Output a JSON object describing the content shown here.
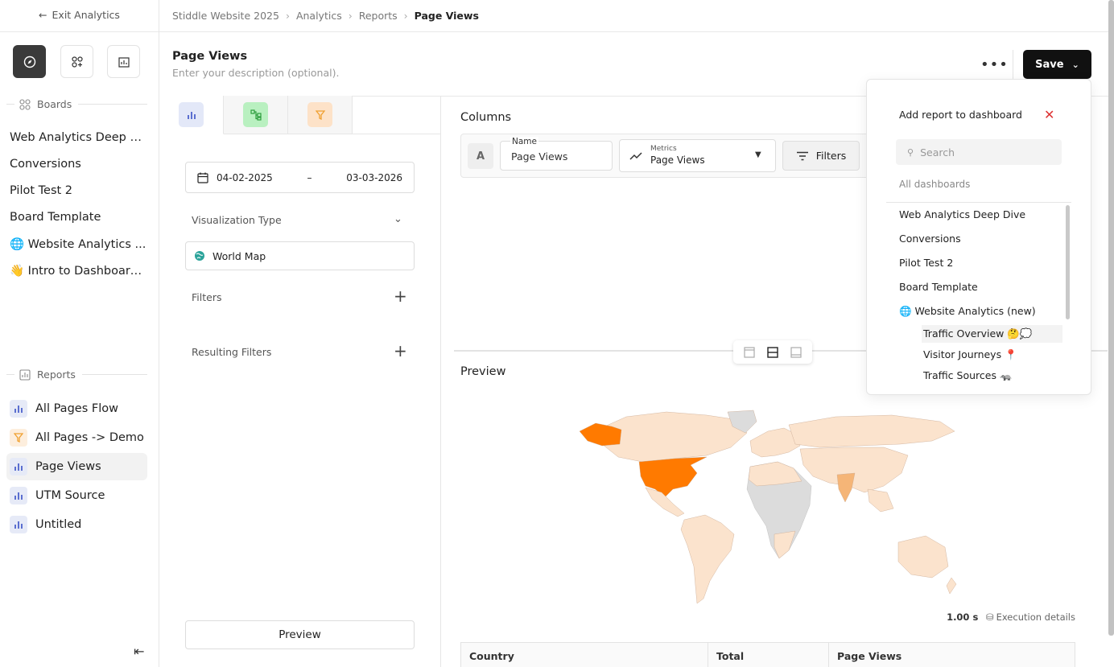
{
  "sidebar": {
    "exit_label": "Exit Analytics",
    "boards_header": "Boards",
    "boards": [
      {
        "label": "Web Analytics Deep D..."
      },
      {
        "label": "Conversions"
      },
      {
        "label": "Pilot Test 2"
      },
      {
        "label": "Board Template"
      },
      {
        "label": "🌐 Website Analytics ..."
      },
      {
        "label": "👋 Intro to Dashboard..."
      }
    ],
    "reports_header": "Reports",
    "reports": [
      {
        "label": "All Pages Flow",
        "icon": "bar-chart-icon"
      },
      {
        "label": "All Pages -> Demo",
        "icon": "funnel-icon"
      },
      {
        "label": "Page Views",
        "icon": "bar-chart-icon",
        "active": true
      },
      {
        "label": "UTM Source",
        "icon": "bar-chart-icon"
      },
      {
        "label": "Untitled",
        "icon": "bar-chart-icon"
      }
    ]
  },
  "breadcrumb": [
    "Stiddle Website 2025",
    "Analytics",
    "Reports",
    "Page Views"
  ],
  "header": {
    "title": "Page Views",
    "description_placeholder": "Enter your description (optional).",
    "more_label": "•••",
    "save_label": "Save"
  },
  "config": {
    "date_start": "04-02-2025",
    "date_sep": "–",
    "date_end": "03-03-2026",
    "viz_label": "Visualization Type",
    "viz_value": "World Map",
    "filters_label": "Filters",
    "resulting_filters_label": "Resulting Filters",
    "preview_button": "Preview"
  },
  "columns": {
    "header": "Columns",
    "row_badge": "A",
    "name_label": "Name",
    "name_value": "Page Views",
    "metrics_label": "Metrics",
    "metrics_value": "Page Views",
    "filters_button": "Filters"
  },
  "preview": {
    "header": "Preview",
    "exec_time": "1.00 s",
    "exec_label": "Execution details",
    "table_headers": [
      "Country",
      "Total",
      "Page Views"
    ]
  },
  "popover": {
    "title": "Add report to dashboard",
    "search_placeholder": "Search",
    "all_label": "All dashboards",
    "dashboards": [
      "Web Analytics Deep Dive",
      "Conversions",
      "Pilot Test 2",
      "Board Template",
      "🌐 Website Analytics (new)"
    ],
    "sub_items": [
      "Traffic Overview 🤔💭",
      "Visitor Journeys 📍",
      "Traffic Sources 🦡"
    ]
  },
  "colors": {
    "map_highlight": "#ff7a00",
    "map_light": "#fbe3cd",
    "map_nodata": "#dcdcdc",
    "accent_bar": "#5b6fd0",
    "close": "#dd3333"
  }
}
